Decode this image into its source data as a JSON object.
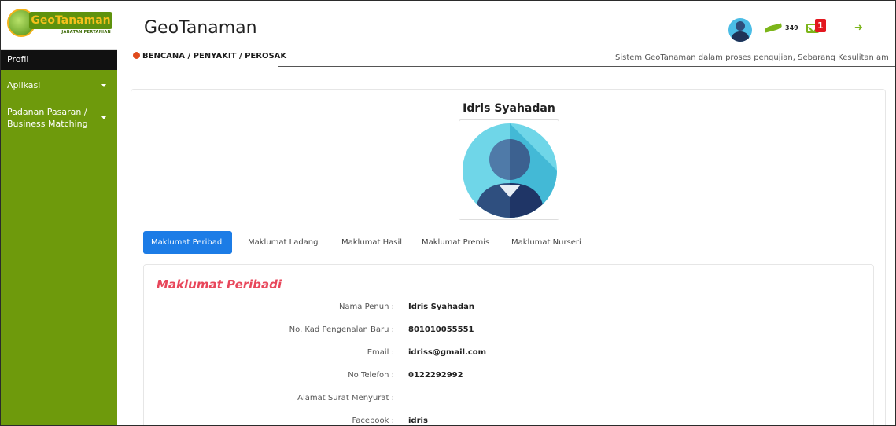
{
  "sidebar": {
    "logo_text": "GeoTanaman",
    "logo_subtitle": "JABATAN PERTANIAN",
    "items": [
      {
        "label": "Profil"
      },
      {
        "label": "Aplikasi"
      },
      {
        "label": "Padanan Pasaran / Business Matching"
      }
    ]
  },
  "header": {
    "title": "GeoTanaman",
    "leaf_count": "349",
    "notification_badge": "1"
  },
  "alert": {
    "label": "BENCANA / PENYAKIT / PEROSAK",
    "ticker": "Sistem GeoTanaman dalam proses pengujian, Sebarang Kesulitan am"
  },
  "profile": {
    "name": "Idris Syahadan",
    "tabs": [
      {
        "label": "Maklumat Peribadi",
        "active": true
      },
      {
        "label": "Maklumat Ladang"
      },
      {
        "label": "Maklumat Hasil"
      },
      {
        "label": "Maklumat Premis"
      },
      {
        "label": "Maklumat Nurseri"
      }
    ],
    "section_title": "Maklumat Peribadi",
    "fields": [
      {
        "label": "Nama Penuh :",
        "value": "Idris Syahadan"
      },
      {
        "label": "No. Kad Pengenalan Baru :",
        "value": "801010055551"
      },
      {
        "label": "Email :",
        "value": "idriss@gmail.com"
      },
      {
        "label": "No Telefon :",
        "value": "0122292992"
      },
      {
        "label": "Alamat Surat Menyurat :",
        "value": ""
      },
      {
        "label": "Facebook :",
        "value": "idris"
      }
    ]
  },
  "colors": {
    "sidebar_green": "#6e9a0c",
    "tab_active_blue": "#1c7ce6",
    "section_title_red": "#e8475b",
    "badge_red": "#e3171f"
  }
}
